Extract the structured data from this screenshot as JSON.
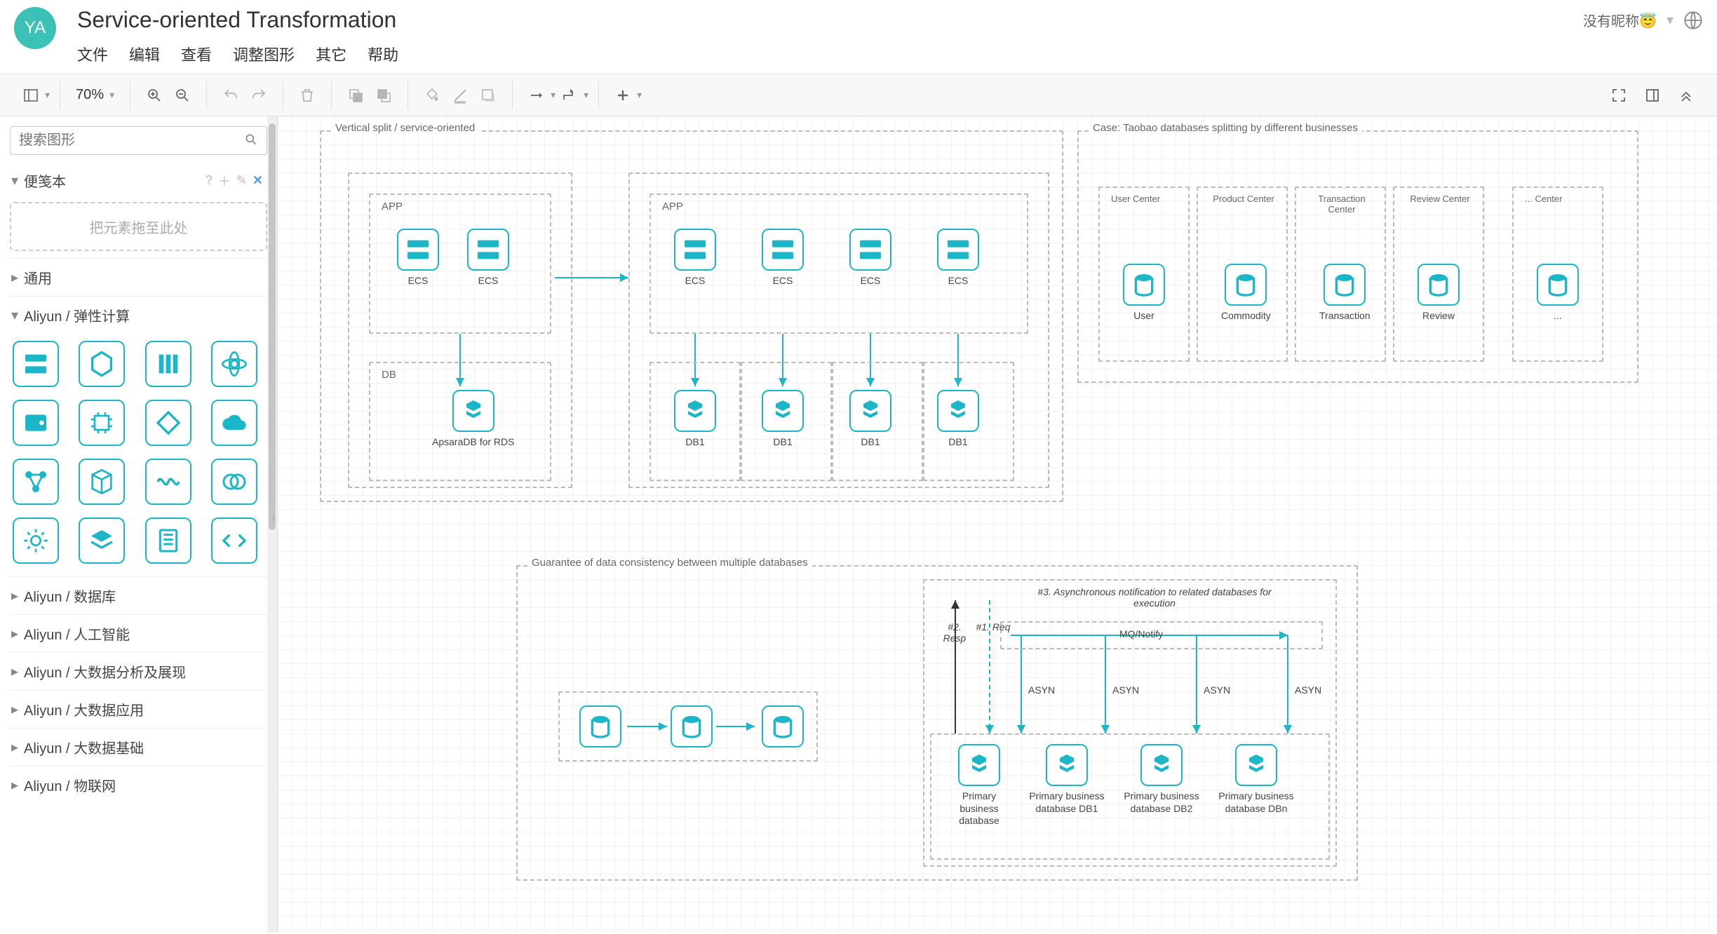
{
  "header": {
    "avatar_initials": "YA",
    "title": "Service-oriented Transformation",
    "menu": {
      "file": "文件",
      "edit": "编辑",
      "view": "查看",
      "adjust": "调整图形",
      "other": "其它",
      "help": "帮助"
    },
    "user_label": "没有昵称😇",
    "user_caret": "▾"
  },
  "toolbar": {
    "zoom_value": "70%"
  },
  "sidebar": {
    "search_placeholder": "搜索图形",
    "scratchpad": {
      "title": "便笺本",
      "help": "?",
      "drop_hint": "把元素拖至此处"
    },
    "sections": {
      "general": "通用",
      "aliyun_elastic": "Aliyun / 弹性计算",
      "aliyun_db": "Aliyun / 数据库",
      "aliyun_ai": "Aliyun / 人工智能",
      "aliyun_bigdata_vis": "Aliyun / 大数据分析及展现",
      "aliyun_bigdata_app": "Aliyun / 大数据应用",
      "aliyun_bigdata_base": "Aliyun / 大数据基础",
      "aliyun_iot": "Aliyun / 物联网"
    }
  },
  "diagram": {
    "vsplit": {
      "title": "Vertical split / service-oriented",
      "app_label": "APP",
      "db_label": "DB",
      "ecs": "ECS",
      "apsara": "ApsaraDB for RDS",
      "db1": "DB1"
    },
    "taobao": {
      "title": "Case: Taobao databases splitting by different businesses",
      "centers": {
        "user_center": "User Center",
        "product_center": "Product Center",
        "transaction_center": "Transaction Center",
        "review_center": "Review Center",
        "dots_center": "... Center"
      },
      "names": {
        "user": "User",
        "commodity": "Commodity",
        "transaction": "Transaction",
        "review": "Review",
        "dots": "..."
      }
    },
    "consistency": {
      "title": "Guarantee of data consistency between multiple databases",
      "note3": "#3. Asynchronous notification to related databases for execution",
      "resp": "#2. Resp",
      "req": "#1. Req",
      "mq": "MQ/Notify",
      "asyn": "ASYN",
      "primary": "Primary business database",
      "primary_db1": "Primary business database DB1",
      "primary_db2": "Primary business database DB2",
      "primary_dbn": "Primary business database DBn"
    }
  }
}
